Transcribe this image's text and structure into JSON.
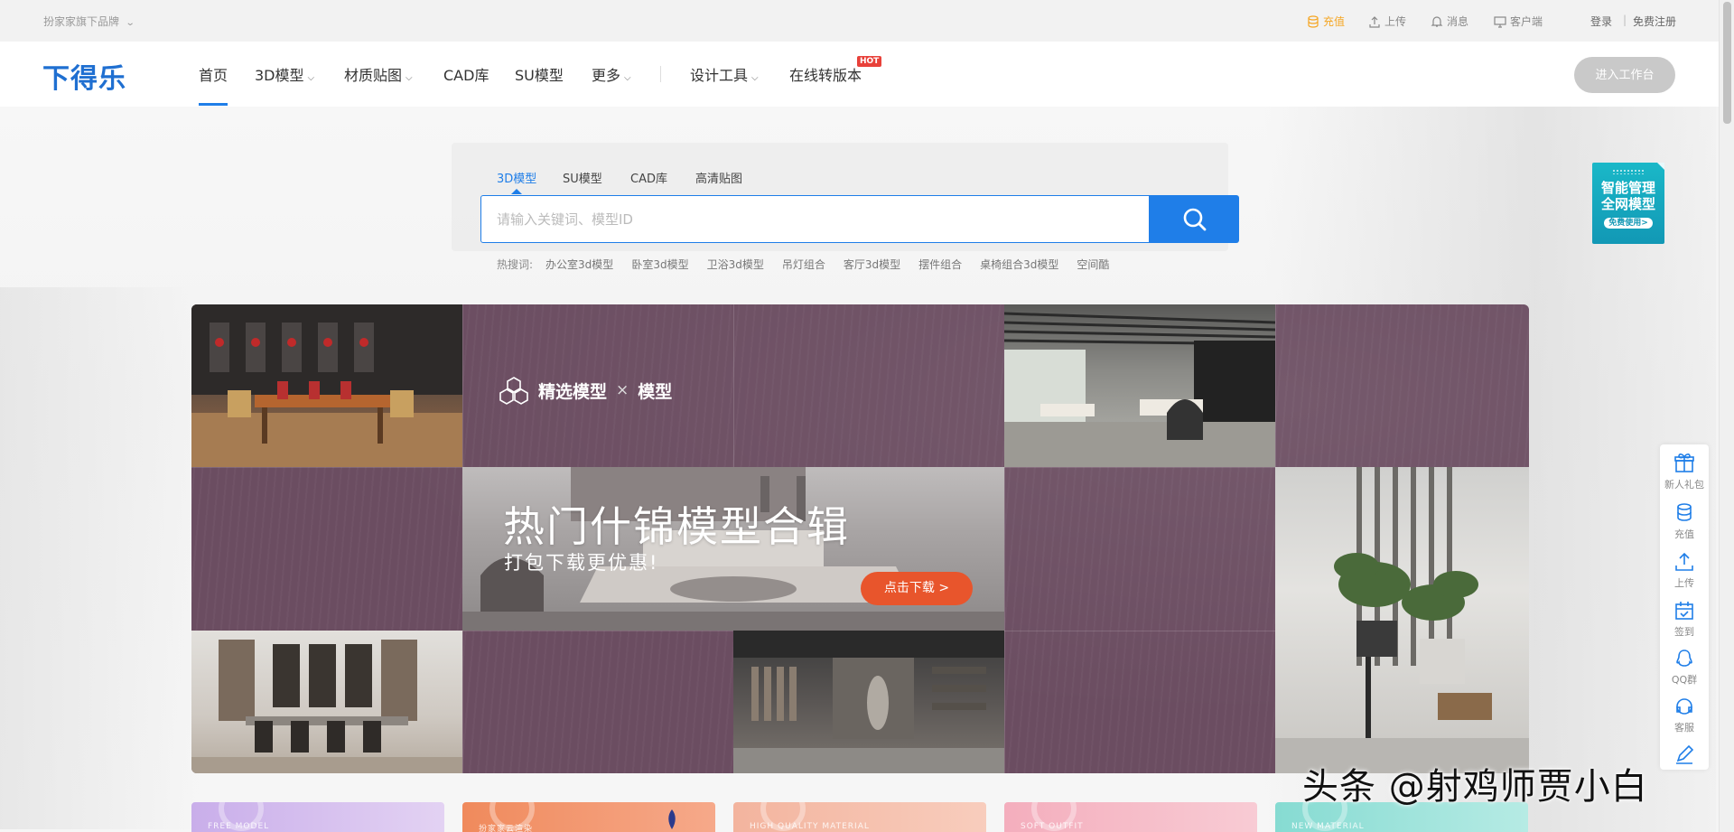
{
  "topbar": {
    "brand_link": "扮家家旗下品牌",
    "recharge": "充值",
    "upload": "上传",
    "messages": "消息",
    "client": "客户端",
    "login": "登录",
    "separator": "|",
    "register": "免费注册"
  },
  "nav": {
    "logo": "下得乐",
    "items": [
      "首页",
      "3D模型",
      "材质贴图",
      "CAD库",
      "SU模型",
      "更多",
      "设计工具",
      "在线转版本"
    ],
    "hot_badge": "HOT",
    "workbench": "进入工作台"
  },
  "search": {
    "tabs": [
      "3D模型",
      "SU模型",
      "CAD库",
      "高清贴图"
    ],
    "active_tab": "3D模型",
    "placeholder": "请输入关键词、模型ID",
    "hot_label": "热搜词:",
    "hot_words": [
      "办公室3d模型",
      "卧室3d模型",
      "卫浴3d模型",
      "吊灯组合",
      "客厅3d模型",
      "摆件组合",
      "桌椅组合3d模型",
      "空间酷"
    ]
  },
  "promo": {
    "line1": "智能管理",
    "line2": "全网模型",
    "button": "免费使用>"
  },
  "banner": {
    "brand": "精选模型",
    "cross": "×",
    "brand2": "模型",
    "title": "热门什锦模型合辑",
    "subtitle": "打包下载更优惠!",
    "cta": "点击下载 >",
    "bg_color": "#6b4d61"
  },
  "side_tools": [
    "新人礼包",
    "充值",
    "上传",
    "签到",
    "QQ群",
    "客服"
  ],
  "categories": [
    {
      "label": "FREE MODEL",
      "color": "#c7a9e8"
    },
    {
      "label": "扮家家云渲染",
      "color": "#f28a5e"
    },
    {
      "label": "HIGH QUALITY MATERIAL",
      "color": "#f2b7a4"
    },
    {
      "label": "SOFT OUTFIT",
      "color": "#f4b3c0"
    },
    {
      "label": "NEW MATERIAL",
      "color": "#8fdcd3"
    }
  ],
  "watermark": "头条 @射鸡师贾小白",
  "colors": {
    "accent": "#1f7ee8",
    "recharge": "#f5a623",
    "cta": "#e8552c",
    "hot": "#e8413a"
  }
}
